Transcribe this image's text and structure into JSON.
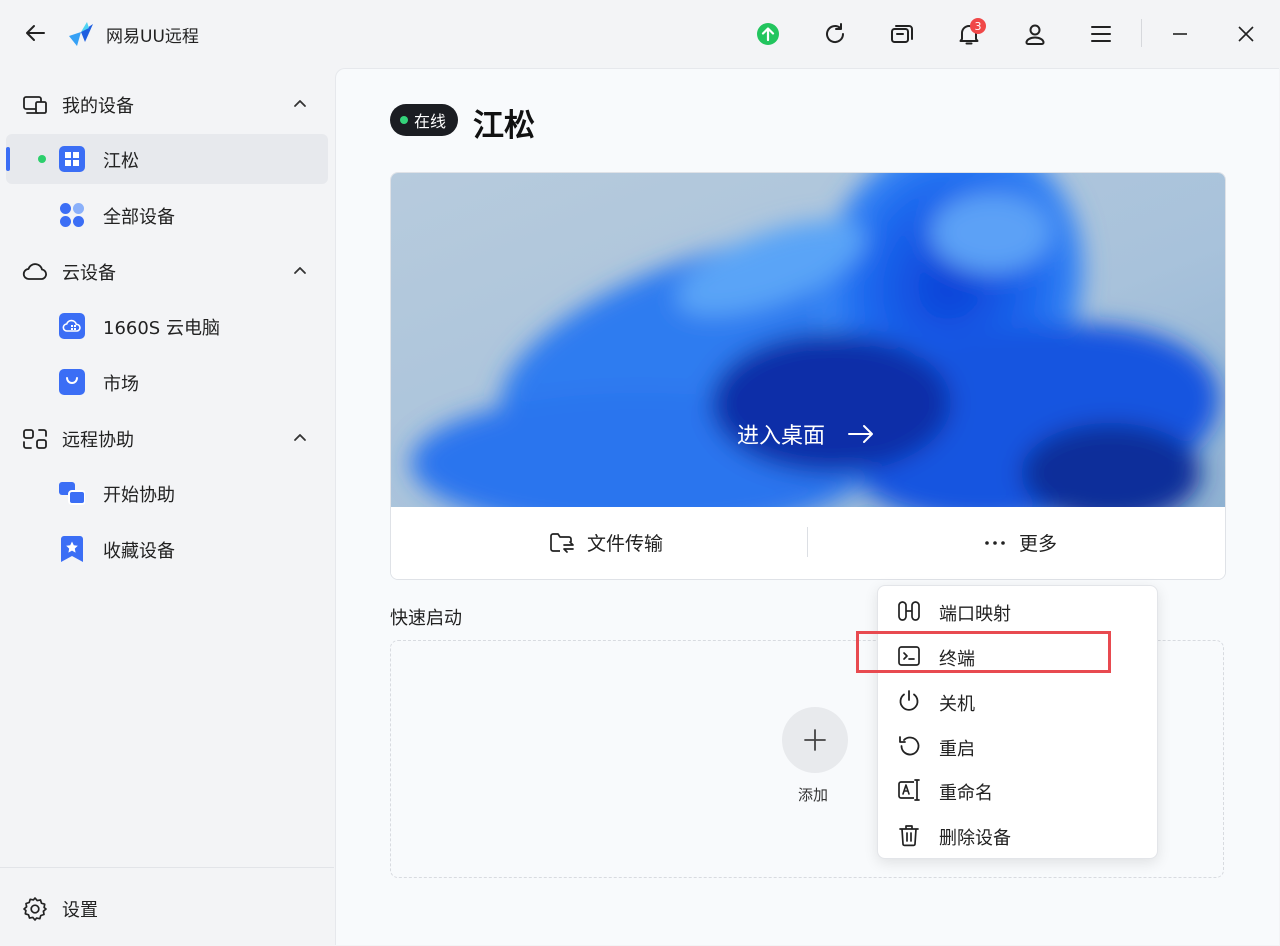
{
  "app": {
    "title": "网易UU远程"
  },
  "titlebar": {
    "notification_count": "3"
  },
  "sidebar": {
    "my_devices": {
      "label": "我的设备",
      "items": [
        {
          "label": "江松",
          "active": true,
          "online": true
        },
        {
          "label": "全部设备"
        }
      ]
    },
    "cloud_devices": {
      "label": "云设备",
      "items": [
        {
          "label": "1660S 云电脑"
        },
        {
          "label": "市场"
        }
      ]
    },
    "remote_assist": {
      "label": "远程协助",
      "items": [
        {
          "label": "开始协助"
        },
        {
          "label": "收藏设备"
        }
      ]
    },
    "settings_label": "设置"
  },
  "device": {
    "status": "在线",
    "name": "江松",
    "enter_desktop": "进入桌面",
    "file_transfer": "文件传输",
    "more": "更多"
  },
  "quick_launch": {
    "title": "快速启动",
    "add_label": "添加"
  },
  "more_menu": {
    "items": [
      {
        "label": "端口映射",
        "icon": "port-mapping-icon"
      },
      {
        "label": "终端",
        "icon": "terminal-icon",
        "highlighted": true
      },
      {
        "label": "关机",
        "icon": "power-icon"
      },
      {
        "label": "重启",
        "icon": "restart-icon"
      },
      {
        "label": "重命名",
        "icon": "rename-icon"
      },
      {
        "label": "删除设备",
        "icon": "trash-icon"
      }
    ]
  },
  "colors": {
    "accent": "#3b6ef5",
    "online": "#2ccf6c",
    "upload_badge": "#22c55e",
    "notification_badge": "#f04848",
    "highlight_box": "#e84a50"
  }
}
